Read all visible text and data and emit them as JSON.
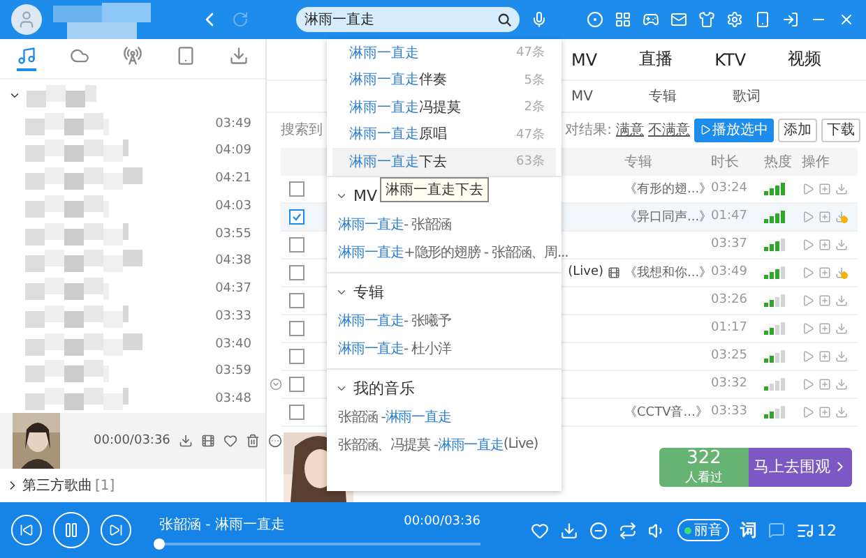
{
  "top_bar": {
    "search": {
      "value": "淋雨一直走"
    }
  },
  "sidebar": {
    "tabs": [
      {
        "kind": "music",
        "selected": true
      },
      {
        "kind": "cloud",
        "selected": false
      },
      {
        "kind": "radio",
        "selected": false
      },
      {
        "kind": "device",
        "selected": false
      },
      {
        "kind": "download",
        "selected": false
      }
    ],
    "durations": [
      "03:49",
      "04:09",
      "04:21",
      "04:03",
      "03:55",
      "04:38",
      "04:37",
      "03:33",
      "03:40",
      "03:59",
      "03:48"
    ],
    "now_card": {
      "time": "00:00/03:36"
    },
    "third_party": {
      "label": "第三方歌曲",
      "count": "[1]"
    }
  },
  "main_tabs": [
    "MV",
    "直播",
    "KTV",
    "视频"
  ],
  "sub_tabs": [
    "MV",
    "专辑",
    "歌词"
  ],
  "toolbar": {
    "found": "搜索到",
    "feedback_label": "对结果:",
    "feedback_links": [
      "满意",
      "不满意"
    ],
    "buttons": [
      {
        "label": "播放选中",
        "kind": "primary"
      },
      {
        "label": "添加",
        "kind": "plain"
      },
      {
        "label": "下载",
        "kind": "plain"
      }
    ]
  },
  "columns": [
    "专辑",
    "时长",
    "热度",
    "操作"
  ],
  "rows": [
    {
      "checked": false,
      "expandable": false,
      "album": "《有形的翅...》",
      "duration": "03:24",
      "kind": "hot",
      "vip": false
    },
    {
      "checked": true,
      "expandable": false,
      "album": "《异口同声...》",
      "duration": "01:47",
      "kind": "hot",
      "vip": true
    },
    {
      "checked": false,
      "expandable": false,
      "duration": "03:37",
      "kind": "warm",
      "vip": false
    },
    {
      "checked": false,
      "expandable": false,
      "tail": "(Live)",
      "album": "《我想和你...》",
      "duration": "03:49",
      "kind": "warm",
      "vip": true
    },
    {
      "checked": false,
      "expandable": false,
      "duration": "03:26",
      "kind": "mild",
      "vip": false
    },
    {
      "checked": false,
      "expandable": false,
      "duration": "01:17",
      "kind": "mild",
      "vip": false
    },
    {
      "checked": false,
      "expandable": false,
      "duration": "03:25",
      "kind": "mild",
      "vip": false
    },
    {
      "checked": false,
      "expandable": true,
      "duration": "03:32",
      "kind": "cold",
      "vip": false
    },
    {
      "checked": false,
      "expandable": false,
      "album": "《CCTV音...》",
      "duration": "03:33",
      "kind": "mild",
      "vip": false
    }
  ],
  "dropdown": {
    "suggestions": [
      {
        "match": "淋雨一直走",
        "count": "47条",
        "hovered": false
      },
      {
        "match": "淋雨一直走",
        "rest": "伴奏",
        "count": "5条",
        "hovered": false
      },
      {
        "match": "淋雨一直走",
        "rest": "冯提莫",
        "count": "2条",
        "hovered": false
      },
      {
        "match": "淋雨一直走",
        "rest": "原唱",
        "count": "47条",
        "hovered": false
      },
      {
        "match": "淋雨一直走",
        "rest": "下去",
        "count": "63条",
        "hovered": true
      }
    ],
    "tooltip": "淋雨一直走下去",
    "sections": [
      {
        "title": "MV",
        "items": [
          {
            "match": "淋雨一直走",
            "post": " - 张韶涵"
          },
          {
            "match": "淋雨一直走",
            "post": "+隐形的翅膀 - 张韶涵、周..."
          }
        ]
      },
      {
        "title": "专辑",
        "items": [
          {
            "match": "淋雨一直走",
            "post": " - 张曦予"
          },
          {
            "match": "淋雨一直走",
            "post": " - 杜小洋"
          }
        ]
      },
      {
        "title": "我的音乐",
        "items": [
          {
            "pre": "张韶涵 - ",
            "match": "淋雨一直走"
          },
          {
            "pre": "张韶涵、冯提莫 - ",
            "match": "淋雨一直走",
            "post": " (Live)"
          }
        ]
      }
    ]
  },
  "promo": {
    "count": "322",
    "count_label": "人看过",
    "action": "马上去围观"
  },
  "player": {
    "title": "张韶涵 - 淋雨一直走",
    "time": "00:00/03:36",
    "level": 0,
    "quality": "丽音",
    "lyrics": "词",
    "queue_count": "12"
  }
}
